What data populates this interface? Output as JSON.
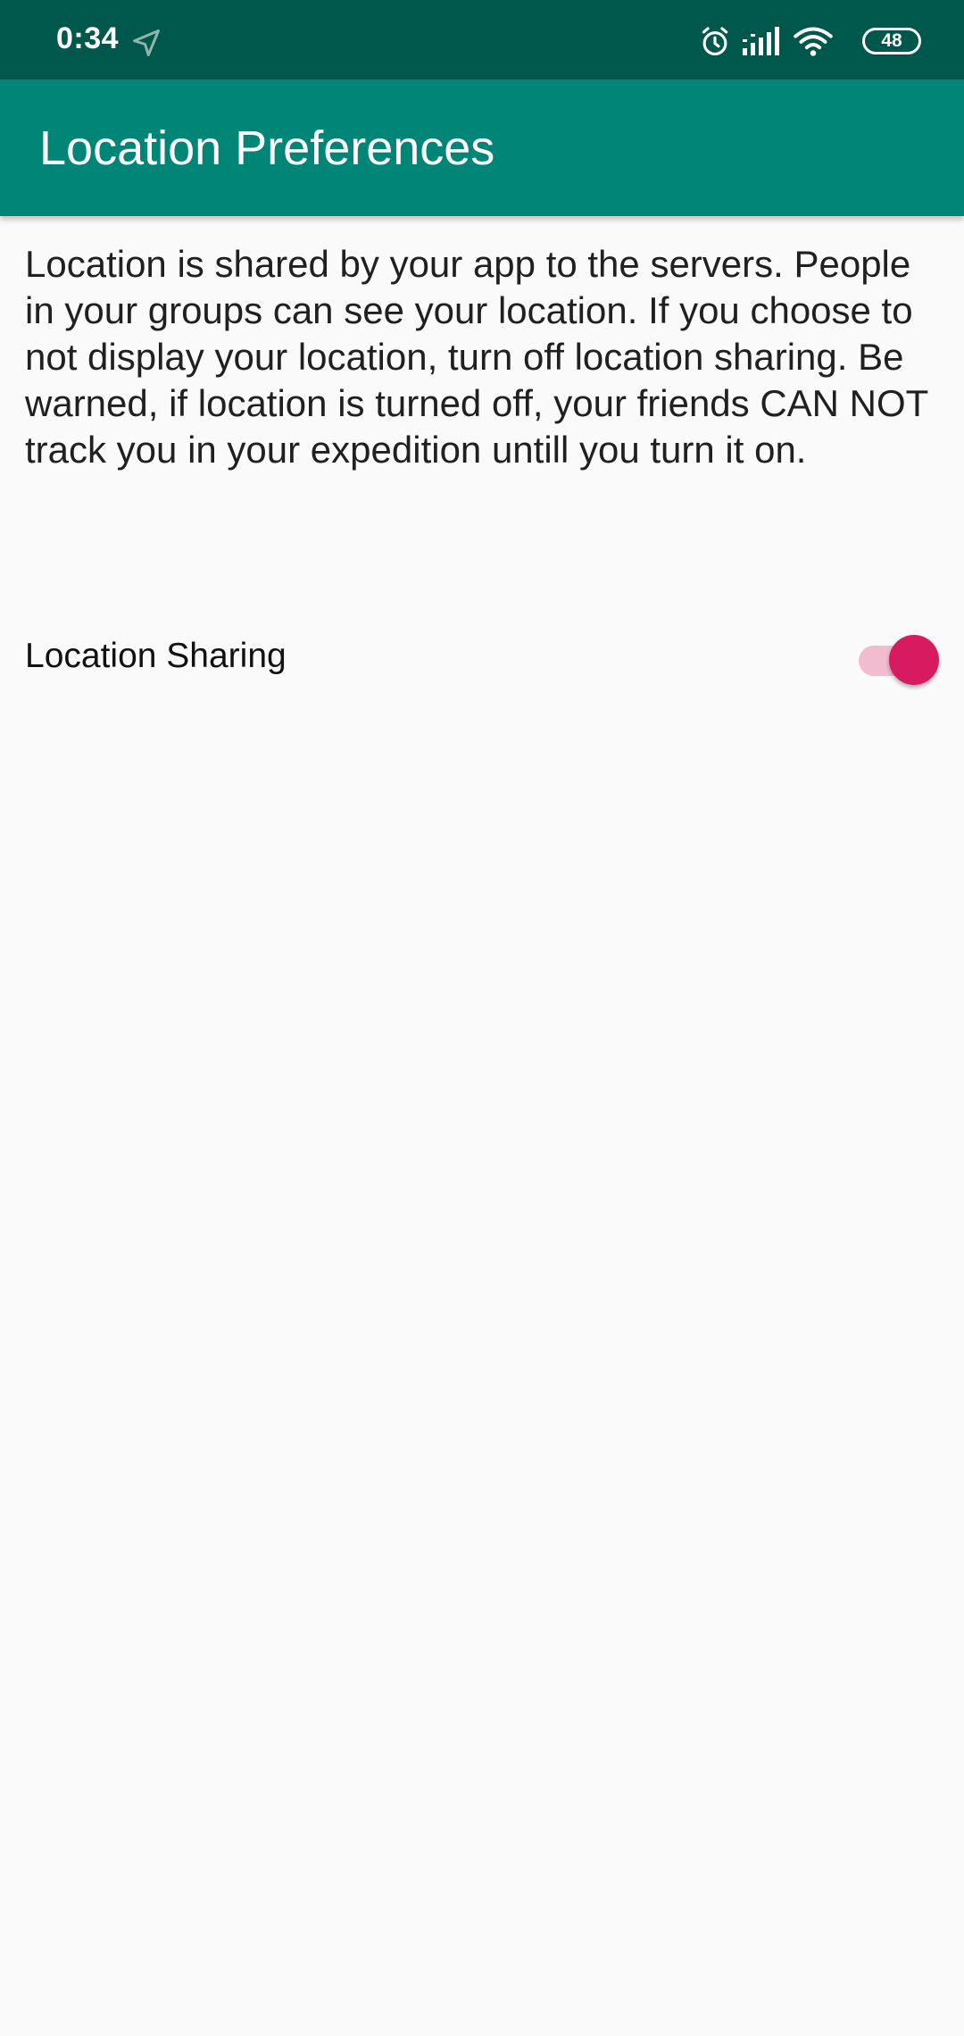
{
  "status_bar": {
    "time": "0:34",
    "battery_level": "48",
    "icons": [
      "navigation-icon",
      "alarm-icon",
      "signal-icon",
      "wifi-icon",
      "battery-icon"
    ]
  },
  "app_bar": {
    "title": "Location Preferences"
  },
  "main": {
    "description": "Location is shared by your app to the servers. People in your groups can see your location. If you choose to not display your location, turn off location sharing. Be warned, if location is turned off, your friends CAN NOT track you in your expedition untill you turn it on.",
    "location_sharing": {
      "label": "Location Sharing",
      "enabled": true
    }
  },
  "colors": {
    "status_bar": "#00574b",
    "app_bar": "#008577",
    "accent": "#d81b60",
    "switch_track": "#f2bcd0",
    "background": "#fafafa"
  }
}
